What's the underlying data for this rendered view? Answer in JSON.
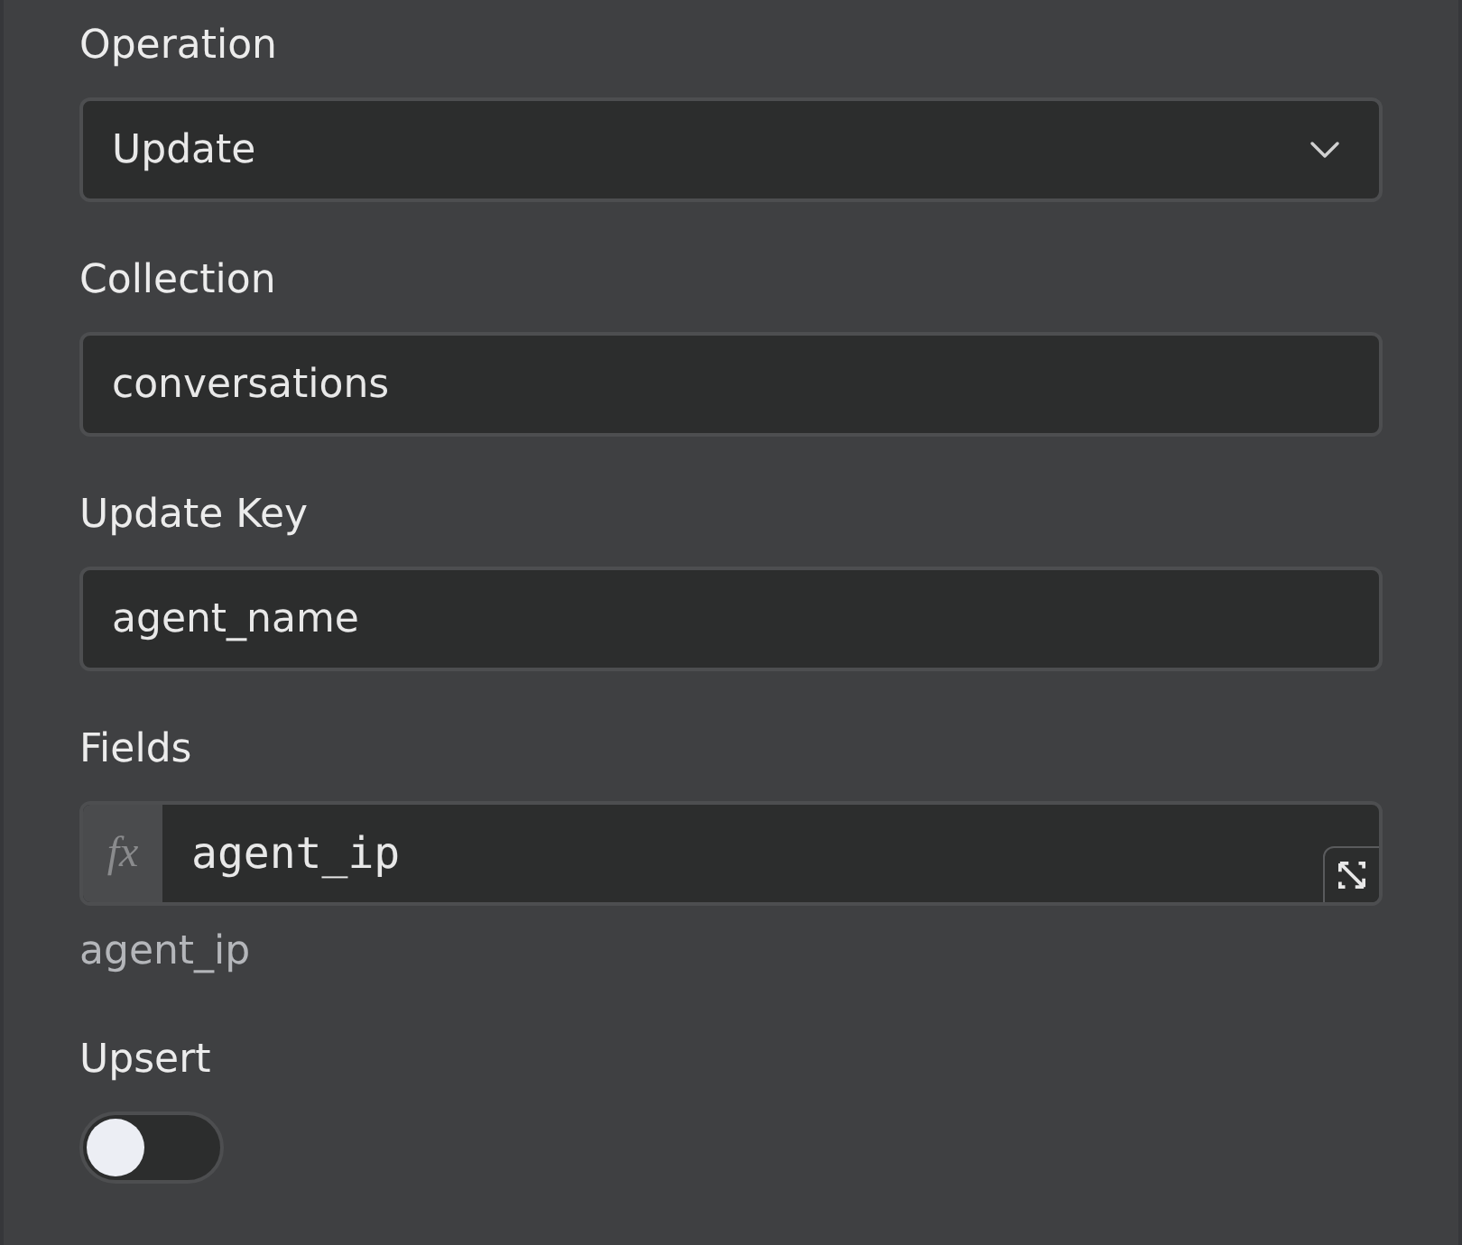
{
  "fields": [
    {
      "kind": "select",
      "label": "Operation",
      "value": "Update"
    },
    {
      "kind": "text",
      "label": "Collection",
      "value": "conversations"
    },
    {
      "kind": "text",
      "label": "Update Key",
      "value": "agent_name"
    },
    {
      "kind": "code",
      "label": "Fields",
      "prefix": "fx",
      "value": "agent_ip",
      "hint": "agent_ip"
    },
    {
      "kind": "toggle",
      "label": "Upsert",
      "on": false
    }
  ]
}
